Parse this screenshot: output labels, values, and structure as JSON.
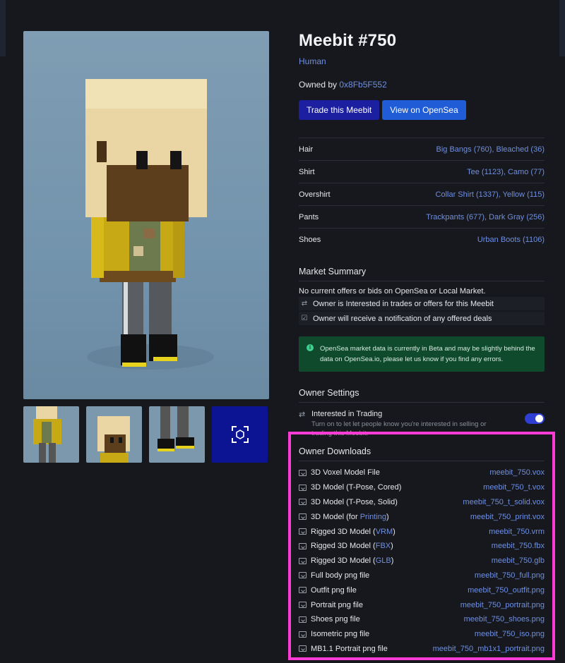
{
  "meebit": {
    "title": "Meebit #750",
    "type": "Human",
    "owned_label": "Owned by",
    "owner": "0x8Fb5F552",
    "buttons": {
      "trade": "Trade this Meebit",
      "view": "View on OpenSea"
    }
  },
  "traits": [
    {
      "name": "Hair",
      "value": "Big Bangs (760), Bleached (36)"
    },
    {
      "name": "Shirt",
      "value": "Tee (1123), Camo (77)"
    },
    {
      "name": "Overshirt",
      "value": "Collar Shirt (1337), Yellow (115)"
    },
    {
      "name": "Pants",
      "value": "Trackpants (677), Dark Gray (256)"
    },
    {
      "name": "Shoes",
      "value": "Urban Boots (1106)"
    }
  ],
  "market": {
    "title": "Market Summary",
    "line": "No current offers or bids on OpenSea or Local Market.",
    "rows": [
      {
        "icon": "swap-icon",
        "text": "Owner is Interested in trades or offers for this Meebit"
      },
      {
        "icon": "inbox-icon",
        "text": "Owner will receive a notification of any offered deals"
      }
    ],
    "notice": "OpenSea market data is currently in Beta and may be slightly behind the data on OpenSea.io, please let us know if you find any errors."
  },
  "owner_settings": {
    "title": "Owner Settings",
    "label": "Interested in Trading",
    "desc": "Turn on to let let people know you're interested in selling or trading this Meebit.",
    "toggle": true
  },
  "downloads": {
    "title": "Owner Downloads",
    "items": [
      {
        "label": "3D Voxel Model File",
        "file": "meebit_750.vox"
      },
      {
        "label": "3D Model (T-Pose, Cored)",
        "file": "meebit_750_t.vox"
      },
      {
        "label": "3D Model (T-Pose, Solid)",
        "file": "meebit_750_t_solid.vox"
      },
      {
        "label_pre": "3D Model (for ",
        "label_link": "Printing",
        "label_post": ")",
        "file": "meebit_750_print.vox"
      },
      {
        "label_pre": "Rigged 3D Model (",
        "label_link": "VRM",
        "label_post": ")",
        "file": "meebit_750.vrm"
      },
      {
        "label_pre": "Rigged 3D Model (",
        "label_link": "FBX",
        "label_post": ")",
        "file": "meebit_750.fbx"
      },
      {
        "label_pre": "Rigged 3D Model (",
        "label_link": "GLB",
        "label_post": ")",
        "file": "meebit_750.glb"
      },
      {
        "label": "Full body png file",
        "file": "meebit_750_full.png"
      },
      {
        "label": "Outfit png file",
        "file": "meebit_750_outfit.png"
      },
      {
        "label": "Portrait png file",
        "file": "meebit_750_portrait.png"
      },
      {
        "label": "Shoes png file",
        "file": "meebit_750_shoes.png"
      },
      {
        "label": "Isometric png file",
        "file": "meebit_750_iso.png"
      },
      {
        "label": "MB1.1 Portrait png file",
        "file": "meebit_750_mb1x1_portrait.png"
      }
    ]
  },
  "colors": {
    "accent": "#6f8fe0",
    "highlight": "#ff3bd6",
    "notice_bg": "#0f4a2c"
  }
}
